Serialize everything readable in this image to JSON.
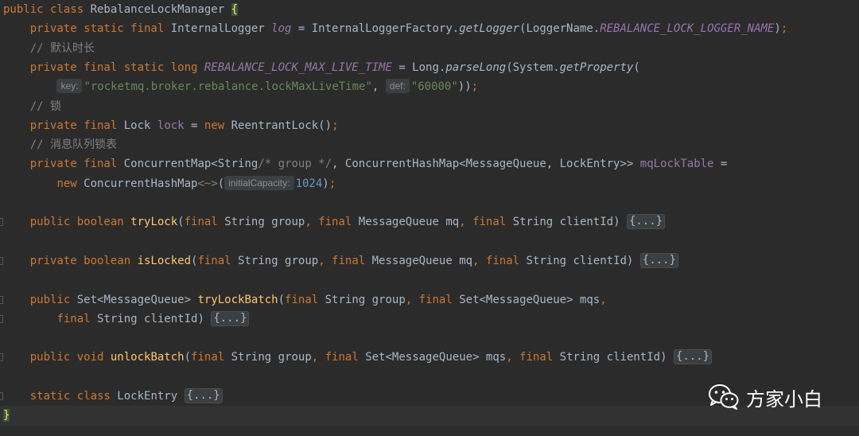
{
  "editor": {
    "lines": [
      {
        "segs": [
          {
            "t": "public class ",
            "c": "kw"
          },
          {
            "t": "RebalanceLockManager "
          },
          {
            "t": "{",
            "c": "brace-hl"
          }
        ]
      },
      {
        "segs": [
          {
            "t": "    "
          },
          {
            "t": "private static final ",
            "c": "kw"
          },
          {
            "t": "InternalLogger "
          },
          {
            "t": "log",
            "c": "const"
          },
          {
            "t": " = InternalLoggerFactory."
          },
          {
            "t": "getLogger",
            "c": "it"
          },
          {
            "t": "(LoggerName."
          },
          {
            "t": "REBALANCE_LOCK_LOGGER_NAME",
            "c": "const"
          },
          {
            "t": ")"
          },
          {
            "t": ";",
            "c": "kw"
          }
        ]
      },
      {
        "segs": [
          {
            "t": "    "
          },
          {
            "t": "// 默认时长",
            "c": "cmt"
          }
        ]
      },
      {
        "segs": [
          {
            "t": "    "
          },
          {
            "t": "private final static long ",
            "c": "kw"
          },
          {
            "t": "REBALANCE_LOCK_MAX_LIVE_TIME",
            "c": "const"
          },
          {
            "t": " = Long."
          },
          {
            "t": "parseLong",
            "c": "it"
          },
          {
            "t": "(System."
          },
          {
            "t": "getProperty",
            "c": "it"
          },
          {
            "t": "("
          }
        ]
      },
      {
        "segs": [
          {
            "t": "        "
          },
          {
            "t": "key:",
            "c": "hint"
          },
          {
            "t": "\"rocketmq.broker.rebalance.lockMaxLiveTime\"",
            "c": "str"
          },
          {
            "t": ","
          },
          {
            "t": " "
          },
          {
            "t": "def:",
            "c": "hint"
          },
          {
            "t": "\"60000\"",
            "c": "str"
          },
          {
            "t": "))"
          },
          {
            "t": ";",
            "c": "kw"
          }
        ]
      },
      {
        "segs": [
          {
            "t": "    "
          },
          {
            "t": "// 锁",
            "c": "cmt"
          }
        ]
      },
      {
        "segs": [
          {
            "t": "    "
          },
          {
            "t": "private final ",
            "c": "kw"
          },
          {
            "t": "Lock "
          },
          {
            "t": "lock",
            "c": "fld"
          },
          {
            "t": " = "
          },
          {
            "t": "new ",
            "c": "kw"
          },
          {
            "t": "ReentrantLock()"
          },
          {
            "t": ";",
            "c": "kw"
          }
        ]
      },
      {
        "segs": [
          {
            "t": "    "
          },
          {
            "t": "// 消息队列锁表",
            "c": "cmt"
          }
        ]
      },
      {
        "segs": [
          {
            "t": "    "
          },
          {
            "t": "private final ",
            "c": "kw"
          },
          {
            "t": "ConcurrentMap<String"
          },
          {
            "t": "/* group */",
            "c": "cmt"
          },
          {
            "t": ", ConcurrentHashMap<MessageQueue, LockEntry>> "
          },
          {
            "t": "mqLockTable",
            "c": "fld"
          },
          {
            "t": " ="
          }
        ]
      },
      {
        "segs": [
          {
            "t": "        "
          },
          {
            "t": "new ",
            "c": "kw"
          },
          {
            "t": "ConcurrentHashMap"
          },
          {
            "t": "<~>",
            "c": "cmt"
          },
          {
            "t": "("
          },
          {
            "t": "initialCapacity:",
            "c": "hint"
          },
          {
            "t": "1024",
            "c": "num"
          },
          {
            "t": ")"
          },
          {
            "t": ";",
            "c": "kw"
          }
        ]
      },
      {
        "segs": []
      },
      {
        "segs": [
          {
            "t": "    "
          },
          {
            "t": "public boolean ",
            "c": "kw"
          },
          {
            "t": "tryLock",
            "c": "fn"
          },
          {
            "t": "("
          },
          {
            "t": "final ",
            "c": "kw"
          },
          {
            "t": "String group"
          },
          {
            "t": ", ",
            "c": "kw"
          },
          {
            "t": "final ",
            "c": "kw"
          },
          {
            "t": "MessageQueue mq"
          },
          {
            "t": ", ",
            "c": "kw"
          },
          {
            "t": "final ",
            "c": "kw"
          },
          {
            "t": "String clientId) "
          },
          {
            "t": "{...}",
            "c": "fold"
          }
        ]
      },
      {
        "segs": []
      },
      {
        "segs": [
          {
            "t": "    "
          },
          {
            "t": "private boolean ",
            "c": "kw"
          },
          {
            "t": "isLocked",
            "c": "fn"
          },
          {
            "t": "("
          },
          {
            "t": "final ",
            "c": "kw"
          },
          {
            "t": "String group"
          },
          {
            "t": ", ",
            "c": "kw"
          },
          {
            "t": "final ",
            "c": "kw"
          },
          {
            "t": "MessageQueue mq"
          },
          {
            "t": ", ",
            "c": "kw"
          },
          {
            "t": "final ",
            "c": "kw"
          },
          {
            "t": "String clientId) "
          },
          {
            "t": "{...}",
            "c": "fold"
          }
        ]
      },
      {
        "segs": []
      },
      {
        "segs": [
          {
            "t": "    "
          },
          {
            "t": "public ",
            "c": "kw"
          },
          {
            "t": "Set<MessageQueue> "
          },
          {
            "t": "tryLockBatch",
            "c": "fn"
          },
          {
            "t": "("
          },
          {
            "t": "final ",
            "c": "kw"
          },
          {
            "t": "String group"
          },
          {
            "t": ", ",
            "c": "kw"
          },
          {
            "t": "final ",
            "c": "kw"
          },
          {
            "t": "Set<MessageQueue> mqs"
          },
          {
            "t": ",",
            "c": "kw"
          }
        ]
      },
      {
        "segs": [
          {
            "t": "        "
          },
          {
            "t": "final ",
            "c": "kw"
          },
          {
            "t": "String clientId) "
          },
          {
            "t": "{...}",
            "c": "fold"
          }
        ]
      },
      {
        "segs": []
      },
      {
        "segs": [
          {
            "t": "    "
          },
          {
            "t": "public void ",
            "c": "kw"
          },
          {
            "t": "unlockBatch",
            "c": "fn"
          },
          {
            "t": "("
          },
          {
            "t": "final ",
            "c": "kw"
          },
          {
            "t": "String group"
          },
          {
            "t": ", ",
            "c": "kw"
          },
          {
            "t": "final ",
            "c": "kw"
          },
          {
            "t": "Set<MessageQueue> mqs"
          },
          {
            "t": ", ",
            "c": "kw"
          },
          {
            "t": "final ",
            "c": "kw"
          },
          {
            "t": "String clientId) "
          },
          {
            "t": "{...}",
            "c": "fold"
          }
        ]
      },
      {
        "segs": []
      },
      {
        "segs": [
          {
            "t": "    "
          },
          {
            "t": "static class ",
            "c": "kw"
          },
          {
            "t": "LockEntry "
          },
          {
            "t": "{...}",
            "c": "fold"
          }
        ]
      },
      {
        "segs": [
          {
            "t": "}",
            "c": "brace-hl"
          }
        ]
      }
    ]
  },
  "watermark": {
    "text": "方家小白",
    "icon": "wechat-icon"
  }
}
